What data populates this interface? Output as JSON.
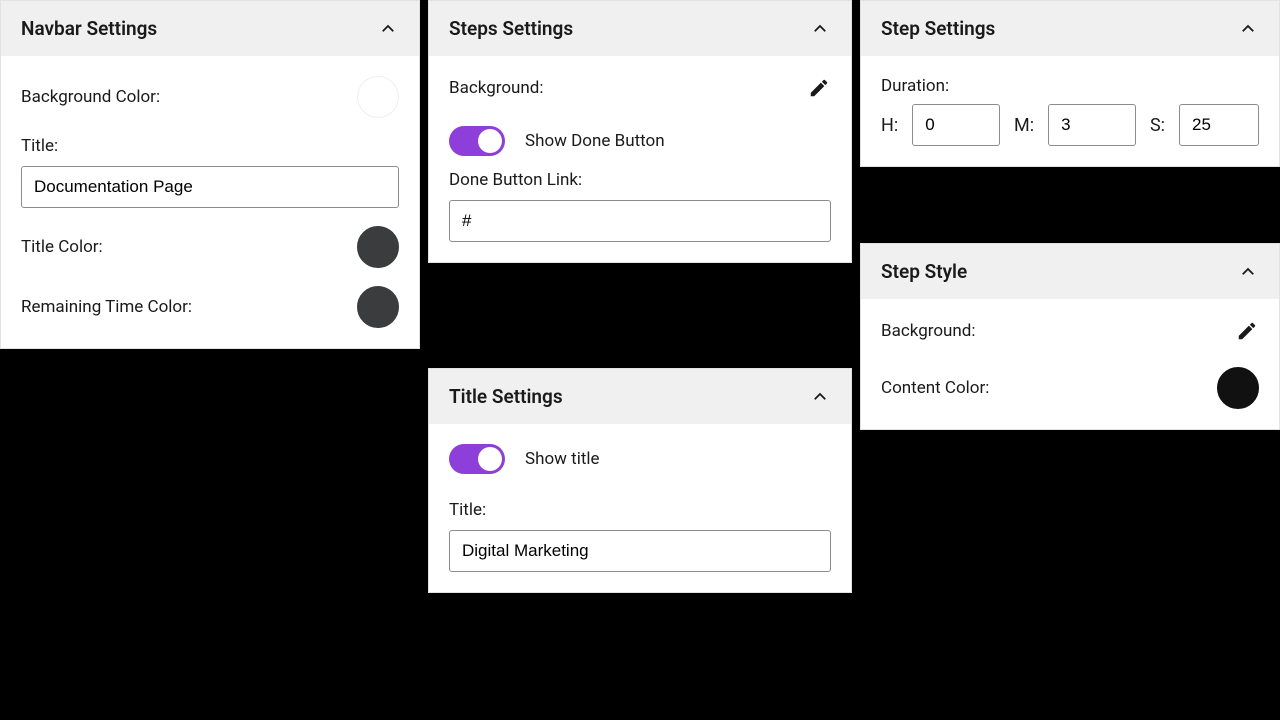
{
  "navbar": {
    "header": "Navbar Settings",
    "bgColorLabel": "Background Color:",
    "titleFieldLabel": "Title:",
    "titleValue": "Documentation Page",
    "titleColorLabel": "Title Color:",
    "remainingLabel": "Remaining Time Color:"
  },
  "steps": {
    "header": "Steps Settings",
    "backgroundLabel": "Background:",
    "showDoneLabel": "Show Done Button",
    "doneLinkLabel": "Done Button Link:",
    "doneLinkValue": "#"
  },
  "titleSettings": {
    "header": "Title Settings",
    "showTitleLabel": "Show title",
    "titleFieldLabel": "Title:",
    "titleValue": "Digital Marketing"
  },
  "stepSettings": {
    "header": "Step Settings",
    "durationLabel": "Duration:",
    "hLabel": "H:",
    "mLabel": "M:",
    "sLabel": "S:",
    "hValue": "0",
    "mValue": "3",
    "sValue": "25"
  },
  "stepStyle": {
    "header": "Step Style",
    "backgroundLabel": "Background:",
    "contentColorLabel": "Content Color:"
  }
}
